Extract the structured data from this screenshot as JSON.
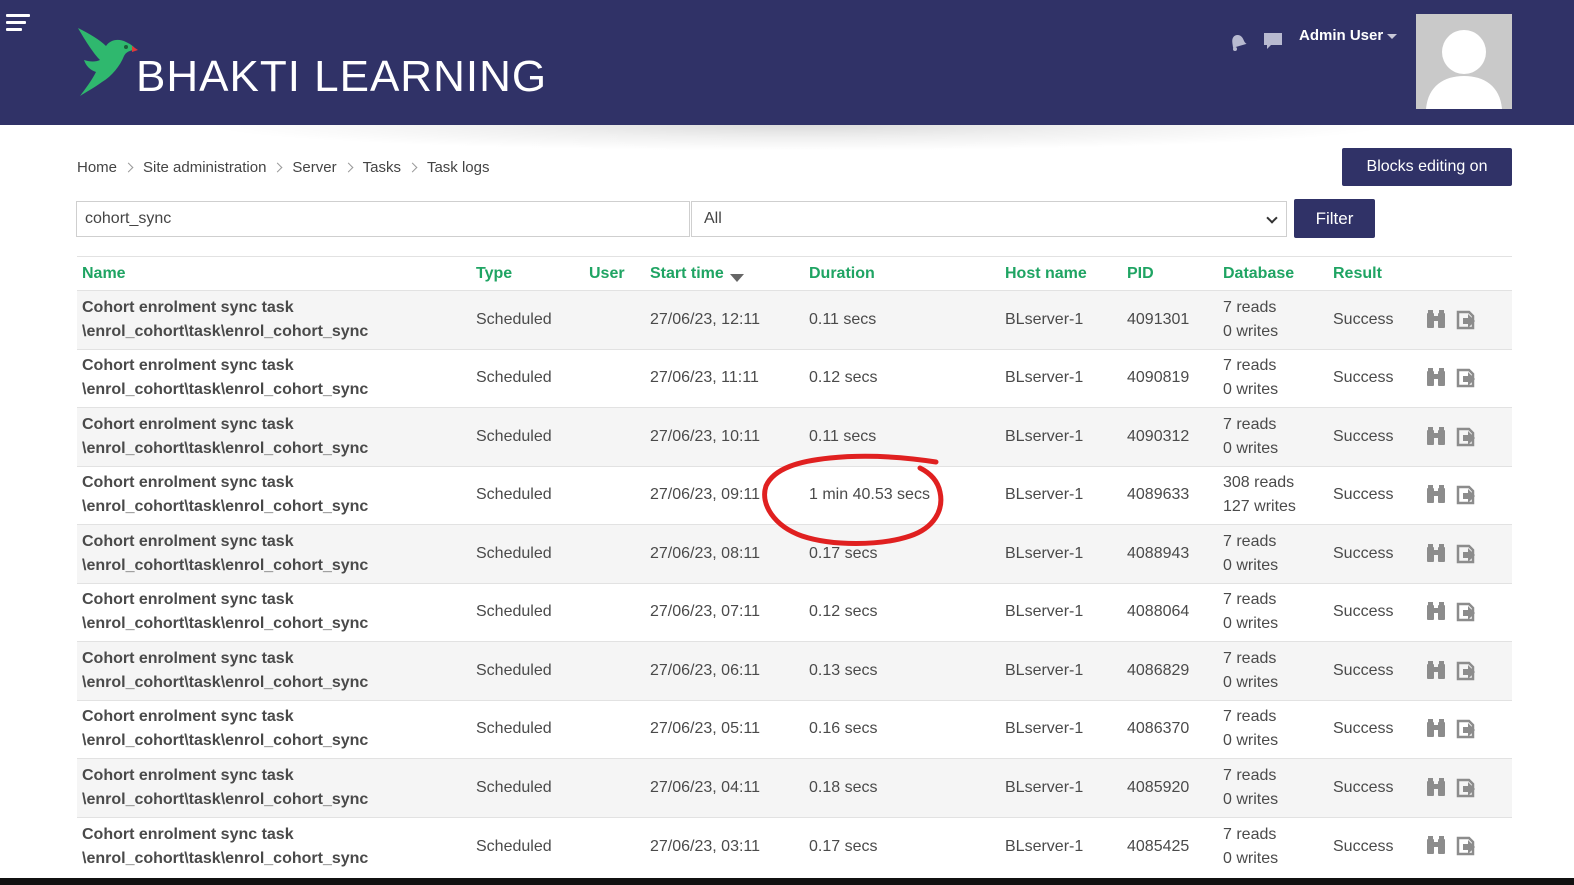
{
  "header": {
    "brand": "BHAKTI LEARNING",
    "user_name": "Admin User",
    "icons": {
      "menu": "hamburger-icon",
      "notifications": "bell-icon",
      "messages": "chat-bubble-icon",
      "logo": "parrot-logo-icon"
    },
    "colors": {
      "bar": "#303267",
      "logo_green": "#2fb86e"
    }
  },
  "breadcrumb": [
    "Home",
    "Site administration",
    "Server",
    "Tasks",
    "Task logs"
  ],
  "blocks_button": "Blocks editing on",
  "filter": {
    "search_value": "cohort_sync",
    "select_value": "All",
    "filter_button": "Filter"
  },
  "table": {
    "columns": [
      "Name",
      "Type",
      "User",
      "Start time",
      "Duration",
      "Host name",
      "PID",
      "Database",
      "Result"
    ],
    "sort_column": "Start time",
    "sort_direction": "descending",
    "header_color": "#1fa463",
    "rows": [
      {
        "name": "Cohort enrolment sync task",
        "classname": "\\enrol_cohort\\task\\enrol_cohort_sync",
        "type": "Scheduled",
        "user": "",
        "start": "27/06/23, 12:11",
        "duration": "0.11 secs",
        "host": "BLserver-1",
        "pid": "4091301",
        "reads": "7 reads",
        "writes": "0 writes",
        "result": "Success"
      },
      {
        "name": "Cohort enrolment sync task",
        "classname": "\\enrol_cohort\\task\\enrol_cohort_sync",
        "type": "Scheduled",
        "user": "",
        "start": "27/06/23, 11:11",
        "duration": "0.12 secs",
        "host": "BLserver-1",
        "pid": "4090819",
        "reads": "7 reads",
        "writes": "0 writes",
        "result": "Success"
      },
      {
        "name": "Cohort enrolment sync task",
        "classname": "\\enrol_cohort\\task\\enrol_cohort_sync",
        "type": "Scheduled",
        "user": "",
        "start": "27/06/23, 10:11",
        "duration": "0.11 secs",
        "host": "BLserver-1",
        "pid": "4090312",
        "reads": "7 reads",
        "writes": "0 writes",
        "result": "Success"
      },
      {
        "name": "Cohort enrolment sync task",
        "classname": "\\enrol_cohort\\task\\enrol_cohort_sync",
        "type": "Scheduled",
        "user": "",
        "start": "27/06/23, 09:11",
        "duration": "1 min 40.53 secs",
        "host": "BLserver-1",
        "pid": "4089633",
        "reads": "308 reads",
        "writes": "127 writes",
        "result": "Success"
      },
      {
        "name": "Cohort enrolment sync task",
        "classname": "\\enrol_cohort\\task\\enrol_cohort_sync",
        "type": "Scheduled",
        "user": "",
        "start": "27/06/23, 08:11",
        "duration": "0.17 secs",
        "host": "BLserver-1",
        "pid": "4088943",
        "reads": "7 reads",
        "writes": "0 writes",
        "result": "Success"
      },
      {
        "name": "Cohort enrolment sync task",
        "classname": "\\enrol_cohort\\task\\enrol_cohort_sync",
        "type": "Scheduled",
        "user": "",
        "start": "27/06/23, 07:11",
        "duration": "0.12 secs",
        "host": "BLserver-1",
        "pid": "4088064",
        "reads": "7 reads",
        "writes": "0 writes",
        "result": "Success"
      },
      {
        "name": "Cohort enrolment sync task",
        "classname": "\\enrol_cohort\\task\\enrol_cohort_sync",
        "type": "Scheduled",
        "user": "",
        "start": "27/06/23, 06:11",
        "duration": "0.13 secs",
        "host": "BLserver-1",
        "pid": "4086829",
        "reads": "7 reads",
        "writes": "0 writes",
        "result": "Success"
      },
      {
        "name": "Cohort enrolment sync task",
        "classname": "\\enrol_cohort\\task\\enrol_cohort_sync",
        "type": "Scheduled",
        "user": "",
        "start": "27/06/23, 05:11",
        "duration": "0.16 secs",
        "host": "BLserver-1",
        "pid": "4086370",
        "reads": "7 reads",
        "writes": "0 writes",
        "result": "Success"
      },
      {
        "name": "Cohort enrolment sync task",
        "classname": "\\enrol_cohort\\task\\enrol_cohort_sync",
        "type": "Scheduled",
        "user": "",
        "start": "27/06/23, 04:11",
        "duration": "0.18 secs",
        "host": "BLserver-1",
        "pid": "4085920",
        "reads": "7 reads",
        "writes": "0 writes",
        "result": "Success"
      },
      {
        "name": "Cohort enrolment sync task",
        "classname": "\\enrol_cohort\\task\\enrol_cohort_sync",
        "type": "Scheduled",
        "user": "",
        "start": "27/06/23, 03:11",
        "duration": "0.17 secs",
        "host": "BLserver-1",
        "pid": "4085425",
        "reads": "7 reads",
        "writes": "0 writes",
        "result": "Success"
      }
    ],
    "row_action_icons": [
      "binoculars-view-icon",
      "download-icon"
    ]
  },
  "annotation": {
    "color": "#e02020",
    "highlights_row": 4,
    "highlights_column": "Duration"
  }
}
